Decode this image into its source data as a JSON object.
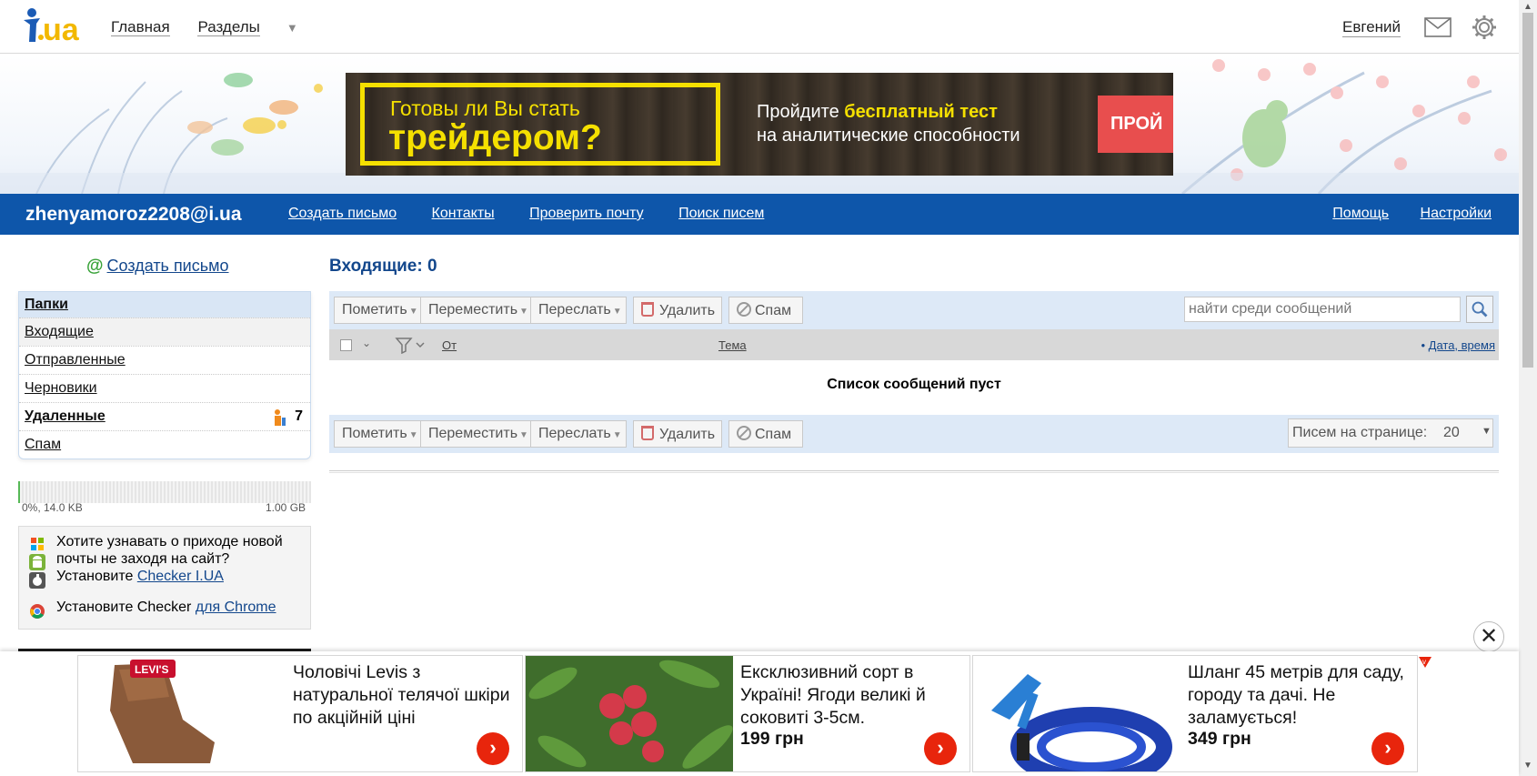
{
  "topbar": {
    "logo_alt": "i.ua",
    "nav": [
      {
        "label": "Главная"
      },
      {
        "label": "Разделы"
      }
    ],
    "user_name": "Евгений"
  },
  "banner": {
    "line1": "Готовы ли Вы стать",
    "line2": "трейдером?",
    "text1_prefix": "Пройдите ",
    "text1_highlight": "бесплатный тест",
    "text2": "на аналитические способности",
    "button_label": "ПРОЙ"
  },
  "bluebar": {
    "account": "zhenyamoroz2208@i.ua",
    "nav": [
      "Создать письмо",
      "Контакты",
      "Проверить почту",
      "Поиск писем"
    ],
    "right": [
      "Помощь",
      "Настройки"
    ]
  },
  "sidebar": {
    "compose_label": "Создать письмо",
    "folders_title": "Папки",
    "folders": [
      {
        "label": "Входящие"
      },
      {
        "label": "Отправленные"
      },
      {
        "label": "Черновики"
      },
      {
        "label": "Удаленные",
        "count": "7"
      },
      {
        "label": "Спам"
      }
    ],
    "storage": {
      "used": "0%, 14.0 KB",
      "total": "1.00 GB",
      "fill_fraction": 0.0
    },
    "checker": {
      "line1": "Хотите узнавать о приходе новой",
      "line2": "почты не заходя на сайт?",
      "line3_prefix": "Установите ",
      "line3_link": "Checker I.UA",
      "line4_prefix": "Установите Checker ",
      "line4_link": "для Chrome"
    }
  },
  "main": {
    "inbox_title": "Входящие: 0",
    "toolbar": {
      "mark": "Пометить",
      "move": "Переместить",
      "forward": "Переслать",
      "delete": "Удалить",
      "spam": "Спам",
      "search_placeholder": "найти среди сообщений"
    },
    "columns": {
      "from": "От",
      "subject": "Тема",
      "date": "Дата, время"
    },
    "empty": "Список сообщений пуст",
    "per_page_label": "Писем на странице:",
    "per_page_value": "20"
  },
  "ads": [
    {
      "title": "Чоловічі Levis з натуральної телячої шкіри по акційній ціні",
      "price": "",
      "brand": "LEVI'S"
    },
    {
      "title": "Ексклюзивний сорт в Україні! Ягоди великі й соковиті 3-5см.",
      "price": "199 грн"
    },
    {
      "title": "Шланг 45 метрів для саду, городу та дачі. Не заламується!",
      "price": "349 грн"
    }
  ],
  "colors": {
    "brand_blue": "#0e56aa",
    "link": "#13478c",
    "ad_yellow": "#f5e000",
    "go_red": "#e8250c"
  }
}
